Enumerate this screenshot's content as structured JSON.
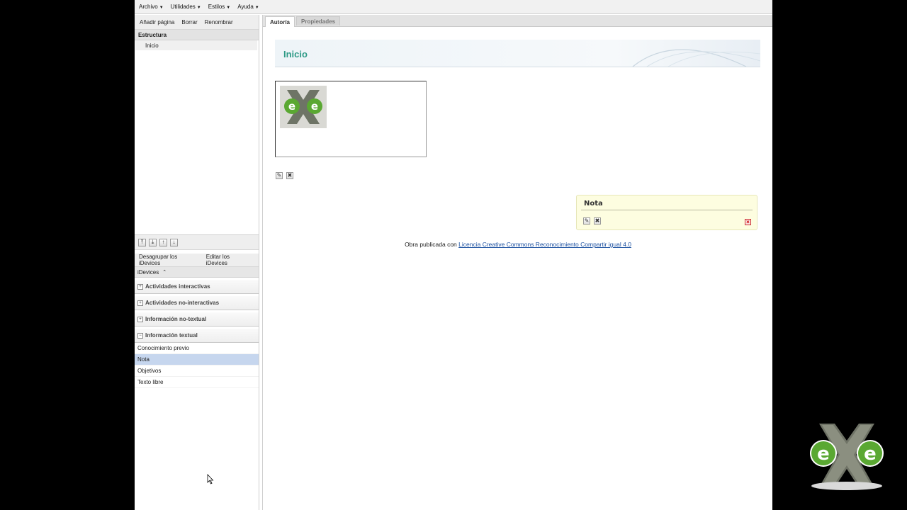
{
  "menubar": {
    "items": [
      "Archivo",
      "Utilidades",
      "Estilos",
      "Ayuda"
    ]
  },
  "left": {
    "toolbar": [
      "Añadir página",
      "Borrar",
      "Renombrar"
    ],
    "structure_title": "Estructura",
    "tree": [
      "Inicio"
    ],
    "idevice_toolbar": [
      "Desagrupar los iDevices",
      "Editar los iDevices"
    ],
    "idevices_title": "iDevices",
    "categories": [
      {
        "label": "Actividades interactivas"
      },
      {
        "label": "Actividades no-interactivas"
      },
      {
        "label": "Información no-textual"
      },
      {
        "label": "Información textual"
      }
    ],
    "textual_items": [
      "Conocimiento previo",
      "Nota",
      "Objetivos",
      "Texto libre"
    ],
    "selected_item": "Nota"
  },
  "right": {
    "tabs": [
      "Autoría",
      "Propiedades"
    ],
    "active_tab": "Autoría",
    "page_title": "Inicio",
    "nota_title": "Nota",
    "footer_text": "Obra publicada con",
    "footer_link": "Licencia Creative Commons Reconocimiento Compartir igual 4.0"
  },
  "colors": {
    "title": "#2e9a86",
    "selected": "#c6d6ee",
    "nota_bg": "#fdfde0",
    "link": "#1a4fa0",
    "logo_green": "#5aa832"
  }
}
